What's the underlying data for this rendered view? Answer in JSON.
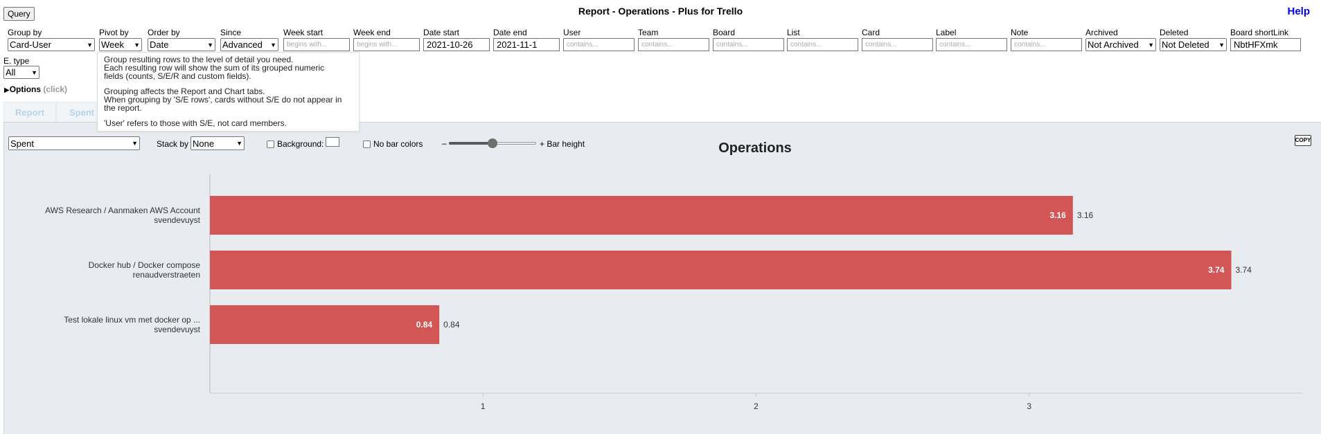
{
  "header": {
    "query_label": "Query",
    "title": "Report - Operations - Plus for Trello",
    "help_label": "Help"
  },
  "filters": [
    {
      "label": "Group by",
      "kind": "select",
      "value": "Card-User"
    },
    {
      "label": "Pivot by",
      "kind": "select",
      "value": "Week"
    },
    {
      "label": "Order by",
      "kind": "select",
      "value": "Date"
    },
    {
      "label": "Since",
      "kind": "select",
      "value": "Advanced"
    },
    {
      "label": "Week start",
      "kind": "input",
      "value": "",
      "placeholder": "begins with..."
    },
    {
      "label": "Week end",
      "kind": "input",
      "value": "",
      "placeholder": "begins with..."
    },
    {
      "label": "Date start",
      "kind": "input",
      "value": "2021-10-26",
      "placeholder": ""
    },
    {
      "label": "Date end",
      "kind": "input",
      "value": "2021-11-1",
      "placeholder": ""
    },
    {
      "label": "User",
      "kind": "input",
      "value": "",
      "placeholder": "contains..."
    },
    {
      "label": "Team",
      "kind": "input",
      "value": "",
      "placeholder": "contains..."
    },
    {
      "label": "Board",
      "kind": "input",
      "value": "",
      "placeholder": "contains..."
    },
    {
      "label": "List",
      "kind": "input",
      "value": "",
      "placeholder": "contains..."
    },
    {
      "label": "Card",
      "kind": "input",
      "value": "",
      "placeholder": "contains..."
    },
    {
      "label": "Label",
      "kind": "input",
      "value": "",
      "placeholder": "contains..."
    },
    {
      "label": "Note",
      "kind": "input",
      "value": "",
      "placeholder": "contains..."
    },
    {
      "label": "Archived",
      "kind": "select",
      "value": "Not Archived"
    },
    {
      "label": "Deleted",
      "kind": "select",
      "value": "Not Deleted"
    },
    {
      "label": "Board shortLink",
      "kind": "input",
      "value": "NbtHFXmk",
      "placeholder": ""
    }
  ],
  "etype": {
    "label": "E. type",
    "value": "All"
  },
  "options": {
    "label": "Options",
    "hint": "(click)"
  },
  "tooltip": {
    "p1_l1": "Group resulting rows to the level of detail you need.",
    "p1_l2": "Each resulting row will show the sum of its grouped numeric",
    "p1_l3": "fields (counts, S/E/R and custom fields).",
    "p2_l1": "Grouping affects the Report and Chart tabs.",
    "p2_l2": "When grouping by 'S/E rows', cards without S/E do not appear in",
    "p2_l3": "the report.",
    "p3_l1": "'User' refers to those with S/E, not card members."
  },
  "tabs": [
    "Report",
    "Spent"
  ],
  "toolbar": {
    "measure_value": "Spent",
    "stack_label": "Stack by",
    "stack_value": "None",
    "background_label": "Background:",
    "nobar_label": "No bar colors",
    "slider_minus": "–",
    "slider_plus": "+ Bar height",
    "slider_level": 0.5,
    "copy_label": "COPY"
  },
  "colors": {
    "bar": "#d35656",
    "panel": "#e8ebef",
    "help": "#0000ee"
  },
  "chart_data": {
    "type": "bar",
    "orientation": "horizontal",
    "title": "Operations",
    "categories": [
      [
        "AWS Research / Aanmaken AWS Account",
        "svendevuyst"
      ],
      [
        "Docker hub / Docker compose",
        "renaudverstraeten"
      ],
      [
        "Test lokale linux vm met docker op ...",
        "svendevuyst"
      ]
    ],
    "values": [
      3.16,
      3.74,
      0.84
    ],
    "value_labels": [
      "3.16",
      "3.74",
      "0.84"
    ],
    "xlim": [
      0,
      4
    ],
    "xticks": [
      1,
      2,
      3
    ],
    "grid": false,
    "bar_color": "#d35656"
  }
}
